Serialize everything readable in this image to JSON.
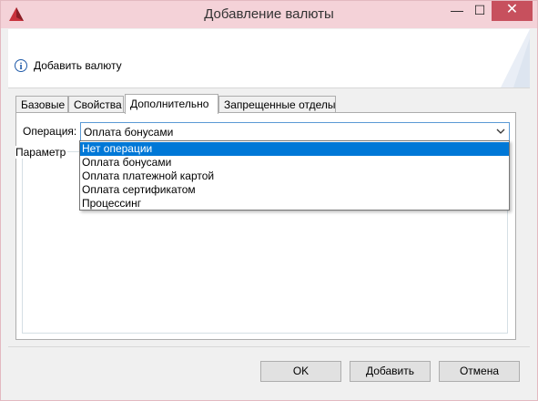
{
  "window": {
    "title": "Добавление валюты",
    "controls": {
      "minimize": "—",
      "maximize": "☐",
      "close": "✕"
    }
  },
  "header": {
    "icon": "info-icon",
    "text": "Добавить валюту"
  },
  "tabs": [
    {
      "label": "Базовые",
      "active": false
    },
    {
      "label": "Свойства",
      "active": false
    },
    {
      "label": "Дополнительно",
      "active": true
    },
    {
      "label": "Запрещенные отделы",
      "active": false
    }
  ],
  "operation": {
    "label": "Операция:",
    "selected": "Оплата бонусами",
    "options": [
      {
        "label": "Нет операции",
        "highlighted": true
      },
      {
        "label": "Оплата бонусами",
        "highlighted": false
      },
      {
        "label": "Оплата платежной картой",
        "highlighted": false
      },
      {
        "label": "Оплата сертификатом",
        "highlighted": false
      },
      {
        "label": "Процессинг",
        "highlighted": false
      }
    ]
  },
  "params_group": {
    "legend": "Параметр"
  },
  "buttons": {
    "ok": "OK",
    "add": "Добавить",
    "cancel": "Отмена"
  },
  "colors": {
    "titlebar": "#f4d2d8",
    "close": "#c7505d",
    "accent": "#0078d7"
  }
}
